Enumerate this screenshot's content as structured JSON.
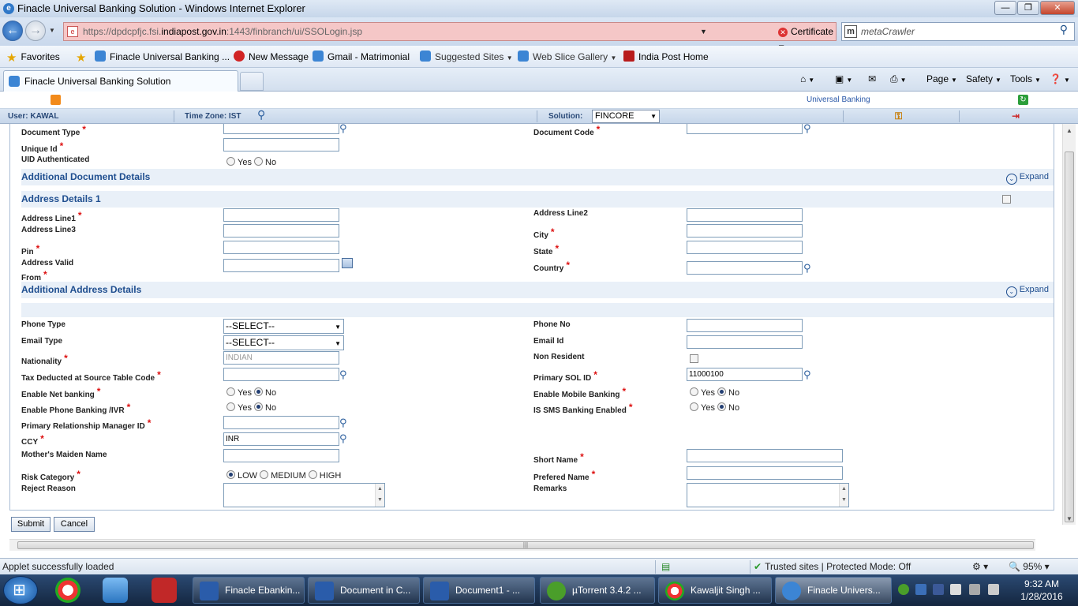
{
  "window": {
    "title": "Finacle Universal Banking Solution - Windows Internet Explorer",
    "url_prefix": "https://dpdcpfjc.fsi.",
    "url_host": "indiapost.gov.in",
    "url_suffix": ":1443/finbranch/ui/SSOLogin.jsp",
    "cert_error": "Certificate Error",
    "search_placeholder": "metaCrawler"
  },
  "favorites": {
    "label": "Favorites",
    "items": [
      "Finacle Universal Banking ...",
      "New Message",
      "Gmail - Matrimonial",
      "Suggested Sites",
      "Web Slice Gallery",
      "India Post  Home"
    ]
  },
  "tabs": {
    "active": "Finacle Universal Banking Solution"
  },
  "commands": {
    "page": "Page",
    "safety": "Safety",
    "tools": "Tools"
  },
  "app": {
    "product_link": "Universal Banking",
    "user_label": "User: KAWAL",
    "timezone_label": "Time Zone:  IST",
    "solution_label": "Solution:",
    "solution_value": "FINCORE"
  },
  "form": {
    "document_type": "Document Type",
    "document_code": "Document Code",
    "unique_id": "Unique Id",
    "uid_authenticated": "UID Authenticated",
    "yes": "Yes",
    "no": "No",
    "additional_document_details": "Additional Document Details",
    "expand": "Expand",
    "address_details_1": "Address Details 1",
    "address_line1": "Address Line1",
    "address_line2": "Address Line2",
    "address_line3": "Address Line3",
    "city": "City",
    "pin": "Pin",
    "state": "State",
    "address_valid": "Address Valid",
    "from": "From",
    "country": "Country",
    "additional_address_details": "Additional Address Details",
    "phone_type": "Phone Type",
    "phone_type_value": "--SELECT--",
    "phone_no": "Phone No",
    "email_type": "Email Type",
    "email_type_value": "--SELECT--",
    "email_id": "Email Id",
    "nationality": "Nationality",
    "nationality_value": "INDIAN",
    "non_resident": "Non Resident",
    "tds_table_code": "Tax Deducted at Source Table Code",
    "primary_sol_id": "Primary SOL ID",
    "primary_sol_id_value": "11000100",
    "enable_net_banking": "Enable Net banking",
    "enable_mobile_banking": "Enable Mobile Banking",
    "enable_phone_banking": "Enable Phone Banking /IVR",
    "is_sms_banking": "IS SMS Banking Enabled",
    "primary_rm_id": "Primary Relationship Manager ID",
    "ccy": "CCY",
    "ccy_value": "INR",
    "mothers_maiden_name": "Mother's Maiden Name",
    "short_name": "Short Name",
    "risk_category": "Risk Category",
    "risk_low": "LOW",
    "risk_medium": "MEDIUM",
    "risk_high": "HIGH",
    "prefered_name": "Prefered Name",
    "reject_reason": "Reject Reason",
    "remarks": "Remarks",
    "submit": "Submit",
    "cancel": "Cancel"
  },
  "status": {
    "left": "Applet successfully loaded",
    "protected": "Trusted sites | Protected Mode: Off",
    "zoom": "95%"
  },
  "taskbar": {
    "tasks": [
      "Finacle Ebankin...",
      "Document in C...",
      "Document1 - ...",
      "µTorrent 3.4.2 ...",
      "Kawaljit Singh ...",
      "Finacle Univers..."
    ],
    "time": "9:32 AM",
    "date": "1/28/2016"
  }
}
